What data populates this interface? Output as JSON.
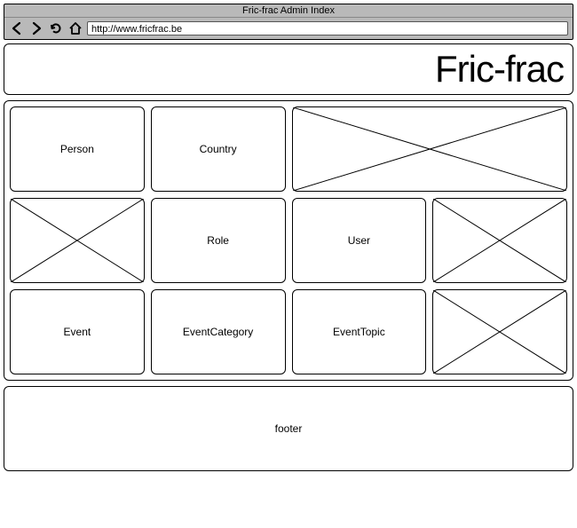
{
  "browser": {
    "title": "Fric-frac Admin Index",
    "url": "http://www.fricfrac.be"
  },
  "header": {
    "title": "Fric-frac"
  },
  "tiles": {
    "person": "Person",
    "country": "Country",
    "role": "Role",
    "user": "User",
    "event": "Event",
    "event_category": "EventCategory",
    "event_topic": "EventTopic"
  },
  "footer": {
    "label": "footer"
  }
}
